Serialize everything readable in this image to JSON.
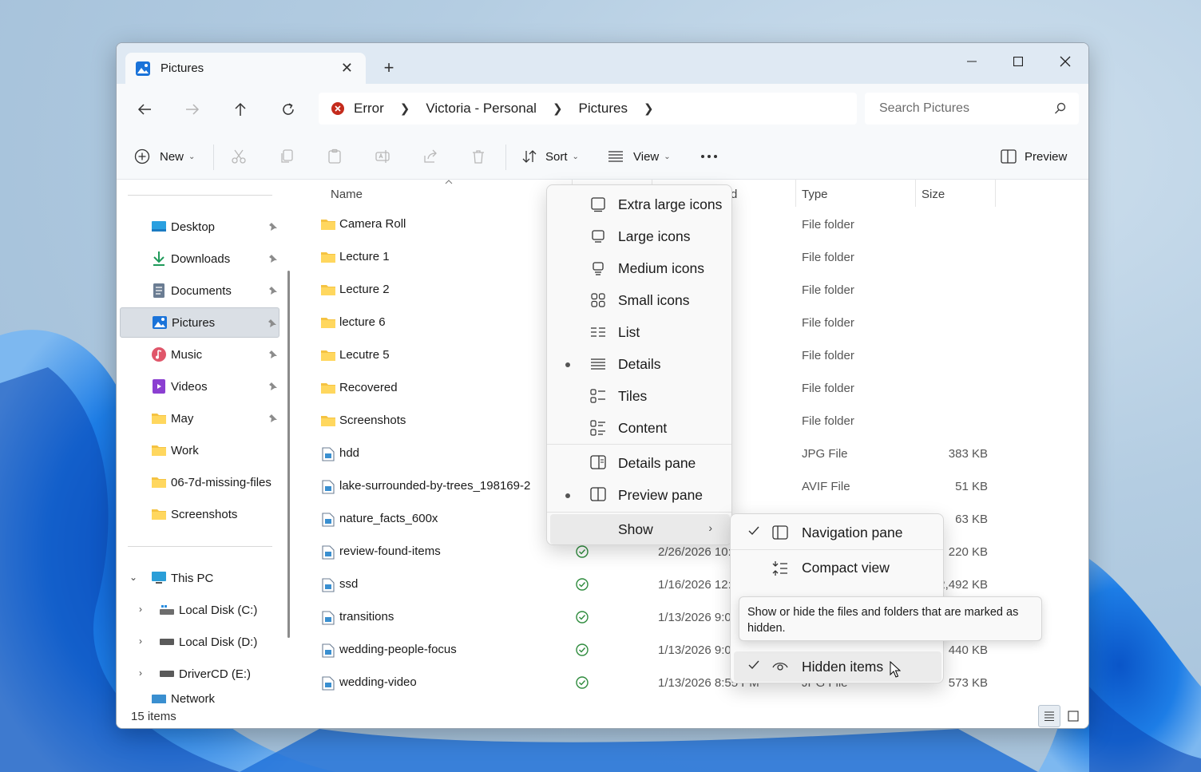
{
  "window": {
    "tab_title": "Pictures",
    "new_tab_symbol": "+",
    "controls": [
      "minimize-icon",
      "maximize-icon",
      "close-icon"
    ]
  },
  "address_bar": {
    "status": "Error",
    "breadcrumbs": [
      "Victoria - Personal",
      "Pictures"
    ]
  },
  "search": {
    "placeholder": "Search Pictures"
  },
  "toolbar": {
    "new_label": "New",
    "sort_label": "Sort",
    "view_label": "View",
    "preview_label": "Preview"
  },
  "sidebar": {
    "quick_access": [
      {
        "label": "Desktop",
        "icon": "desktop-icon",
        "pinned": true
      },
      {
        "label": "Downloads",
        "icon": "download-icon",
        "pinned": true
      },
      {
        "label": "Documents",
        "icon": "documents-icon",
        "pinned": true
      },
      {
        "label": "Pictures",
        "icon": "pictures-icon",
        "pinned": true,
        "selected": true
      },
      {
        "label": "Music",
        "icon": "music-icon",
        "pinned": true
      },
      {
        "label": "Videos",
        "icon": "videos-icon",
        "pinned": true
      },
      {
        "label": "May",
        "icon": "folder-icon",
        "pinned": true
      },
      {
        "label": "Work",
        "icon": "folder-icon",
        "pinned": false
      },
      {
        "label": "06-7d-missing-files",
        "icon": "folder-icon",
        "pinned": false
      },
      {
        "label": "Screenshots",
        "icon": "folder-icon",
        "pinned": false
      }
    ],
    "this_pc": "This PC",
    "drives": [
      "Local Disk (C:)",
      "Local Disk (D:)",
      "DriverCD (E:)"
    ],
    "network_partial": "Network"
  },
  "columns": {
    "name": "Name",
    "date_partial": "d",
    "type": "Type",
    "size": "Size"
  },
  "files": [
    {
      "name": "Camera Roll",
      "kind": "folder",
      "date": "PM",
      "type": "File folder",
      "size": ""
    },
    {
      "name": "Lecture 1",
      "kind": "folder",
      "date": "09 PM",
      "type": "File folder",
      "size": ""
    },
    {
      "name": "Lecture 2",
      "kind": "folder",
      "date": "26 PM",
      "type": "File folder",
      "size": ""
    },
    {
      "name": "lecture 6",
      "kind": "folder",
      "date": "05 PM",
      "type": "File folder",
      "size": ""
    },
    {
      "name": "Lecutre 5",
      "kind": "folder",
      "date": ":54 PM",
      "type": "File folder",
      "size": ""
    },
    {
      "name": "Recovered",
      "kind": "folder",
      "date": "58 PM",
      "type": "File folder",
      "size": ""
    },
    {
      "name": "Screenshots",
      "kind": "folder",
      "date": "PM",
      "type": "File folder",
      "size": ""
    },
    {
      "name": "hdd",
      "kind": "file",
      "date": "14 PM",
      "type": "JPG File",
      "size": "383 KB"
    },
    {
      "name": "lake-surrounded-by-trees_198169-2",
      "kind": "file",
      "date": "AM",
      "type": "AVIF File",
      "size": "51 KB"
    },
    {
      "name": "nature_facts_600x",
      "kind": "file",
      "date": "",
      "type": "",
      "size": "63 KB"
    },
    {
      "name": "review-found-items",
      "kind": "file",
      "status": "synced",
      "date": "2/26/2026 10:",
      "type": "",
      "size": "220 KB"
    },
    {
      "name": "ssd",
      "kind": "file",
      "status": "synced",
      "date": "1/16/2026 12:",
      "type": "",
      "size": "2,492 KB"
    },
    {
      "name": "transitions",
      "kind": "file",
      "status": "synced",
      "date": "1/13/2026 9:0",
      "type": "",
      "size": ""
    },
    {
      "name": "wedding-people-focus",
      "kind": "file",
      "status": "synced",
      "date": "1/13/2026 9:0",
      "type": "",
      "size": "440 KB"
    },
    {
      "name": "wedding-video",
      "kind": "file",
      "status": "synced",
      "date": "1/13/2026 8:55 PM",
      "type": "JPG File",
      "size": "573 KB"
    }
  ],
  "status_bar": {
    "item_count": "15 items"
  },
  "view_menu": {
    "items": [
      {
        "label": "Extra large icons",
        "icon": "extra-large-icons-icon",
        "selected": false
      },
      {
        "label": "Large icons",
        "icon": "large-icons-icon",
        "selected": false
      },
      {
        "label": "Medium icons",
        "icon": "medium-icons-icon",
        "selected": false
      },
      {
        "label": "Small icons",
        "icon": "small-icons-icon",
        "selected": false
      },
      {
        "label": "List",
        "icon": "list-icon",
        "selected": false
      },
      {
        "label": "Details",
        "icon": "details-icon",
        "selected": true
      },
      {
        "label": "Tiles",
        "icon": "tiles-icon",
        "selected": false
      },
      {
        "label": "Content",
        "icon": "content-icon",
        "selected": false
      }
    ],
    "panes": [
      {
        "label": "Details pane",
        "icon": "details-pane-icon",
        "selected": false
      },
      {
        "label": "Preview pane",
        "icon": "preview-pane-icon",
        "selected": true
      }
    ],
    "show_label": "Show"
  },
  "show_submenu": {
    "items": [
      {
        "label": "Navigation pane",
        "icon": "navigation-pane-icon",
        "checked": true
      },
      {
        "label": "Compact view",
        "icon": "compact-view-icon",
        "checked": false
      },
      {
        "label": "Hidden items",
        "icon": "hidden-items-icon",
        "checked": true
      }
    ]
  },
  "tooltip": {
    "text": "Show or hide the files and folders that are marked as hidden."
  },
  "colors": {
    "accent": "#0067c0",
    "synced": "#2e8b3d",
    "folder": "#f5c342",
    "error": "#c42b1c"
  }
}
